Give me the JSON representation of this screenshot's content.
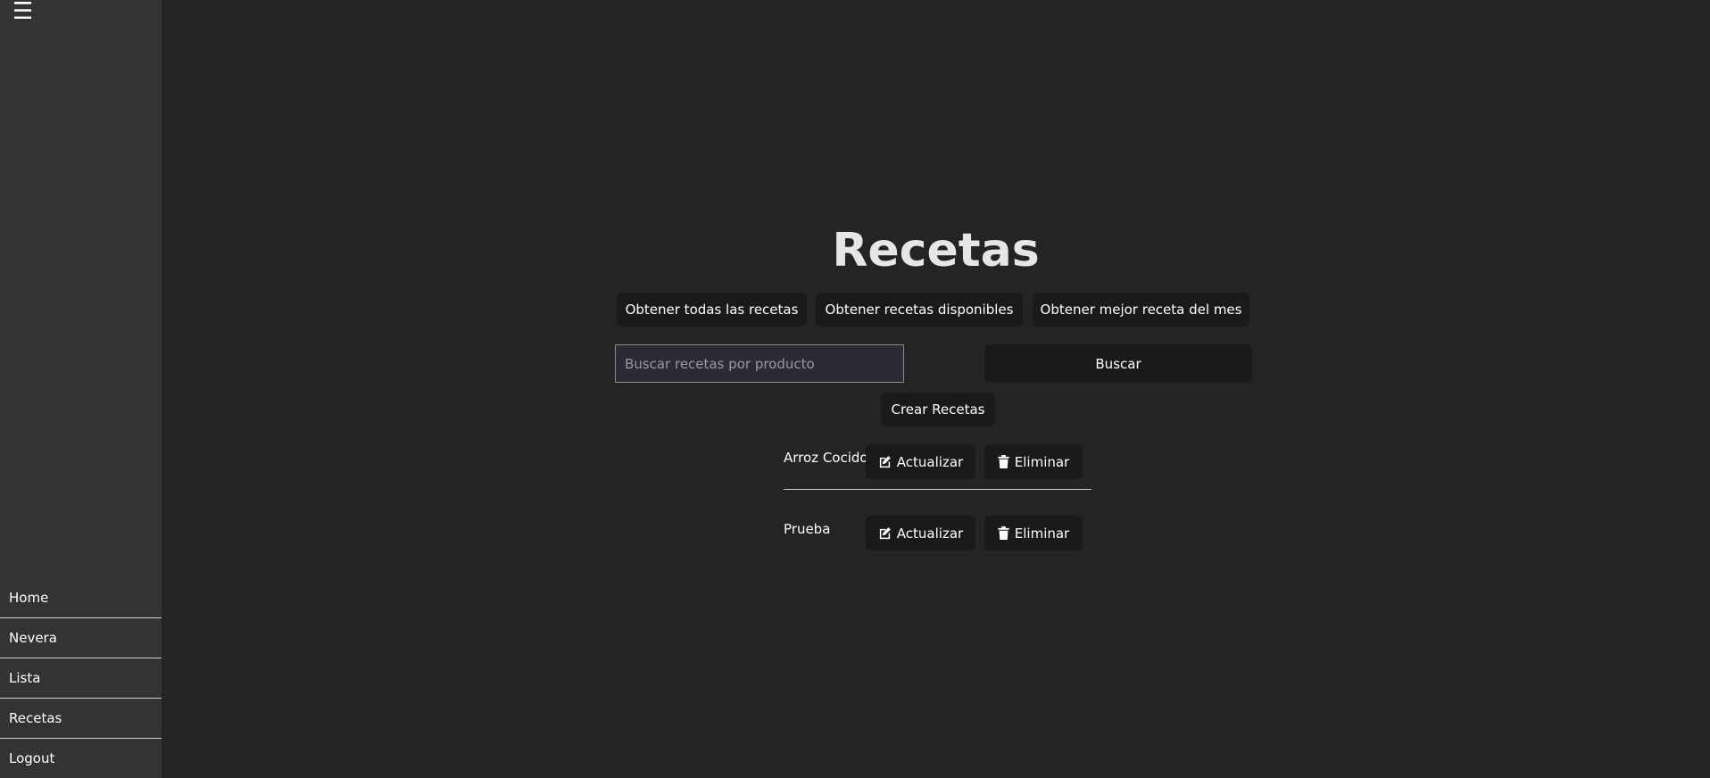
{
  "sidebar": {
    "toggle_icon": "hamburger-icon",
    "toggle_glyph": "☰",
    "items": [
      {
        "label": "Home"
      },
      {
        "label": "Nevera"
      },
      {
        "label": "Lista"
      },
      {
        "label": "Recetas"
      },
      {
        "label": "Logout"
      }
    ]
  },
  "main": {
    "title": "Recetas",
    "buttons": {
      "all": "Obtener todas las recetas",
      "available": "Obtener recetas disponibles",
      "best": "Obtener mejor receta del mes"
    },
    "search": {
      "placeholder": "Buscar recetas por producto",
      "value": "",
      "button": "Buscar"
    },
    "create_button": "Crear Recetas",
    "recipes": [
      {
        "name": "Arroz Cocido",
        "update": "Actualizar",
        "delete": "Eliminar"
      },
      {
        "name": "Prueba",
        "update": "Actualizar",
        "delete": "Eliminar"
      }
    ]
  },
  "colors": {
    "background": "#242424",
    "sidebar": "#333333",
    "button": "#1a1a1a",
    "input": "#2c2a35"
  }
}
